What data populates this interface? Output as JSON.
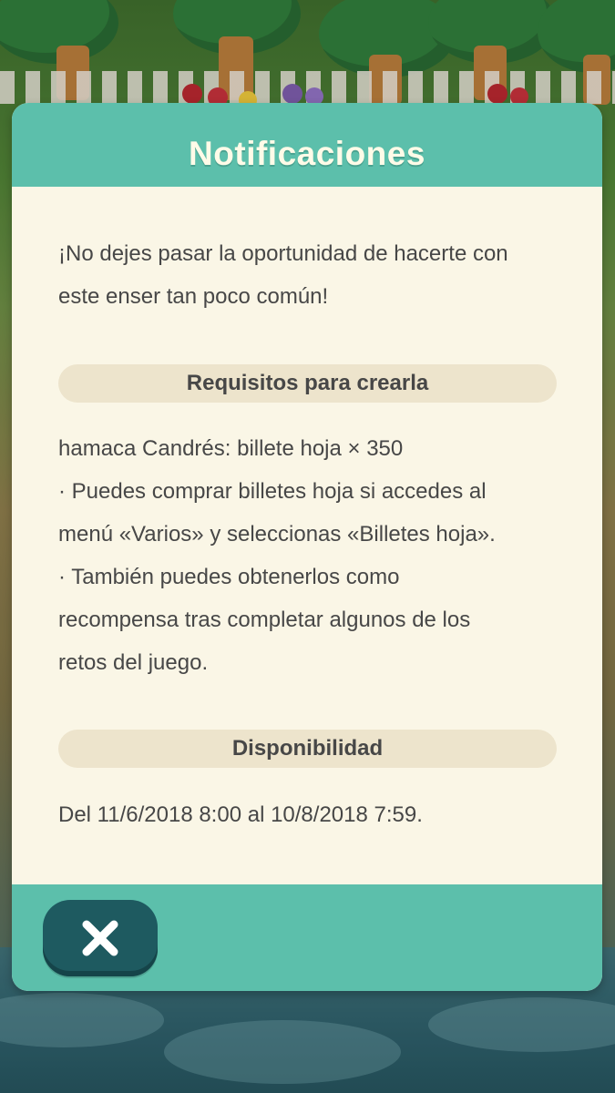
{
  "dialog": {
    "title": "Notificaciones",
    "intro_lines": [
      "¡No dejes pasar la oportunidad de hacerte con",
      "este enser tan poco común!"
    ],
    "requirements": {
      "heading": "Requisitos para crearla",
      "lines": [
        "hamaca Candrés: billete hoja × 350",
        "· Puedes comprar billetes hoja si accedes al",
        "menú «Varios» y seleccionas «Billetes hoja».",
        "· También puedes obtenerlos como",
        "recompensa tras completar algunos de los",
        "retos del juego."
      ]
    },
    "availability": {
      "heading": "Disponibilidad",
      "text": "Del 11/6/2018 8:00 al 10/8/2018 7:59."
    },
    "close_icon": "close-x-icon"
  },
  "colors": {
    "header_footer": "#5cbfab",
    "body_background": "#faf6e6",
    "section_pill": "#ede4cc",
    "close_button": "#1e5a60",
    "text": "#474747"
  }
}
